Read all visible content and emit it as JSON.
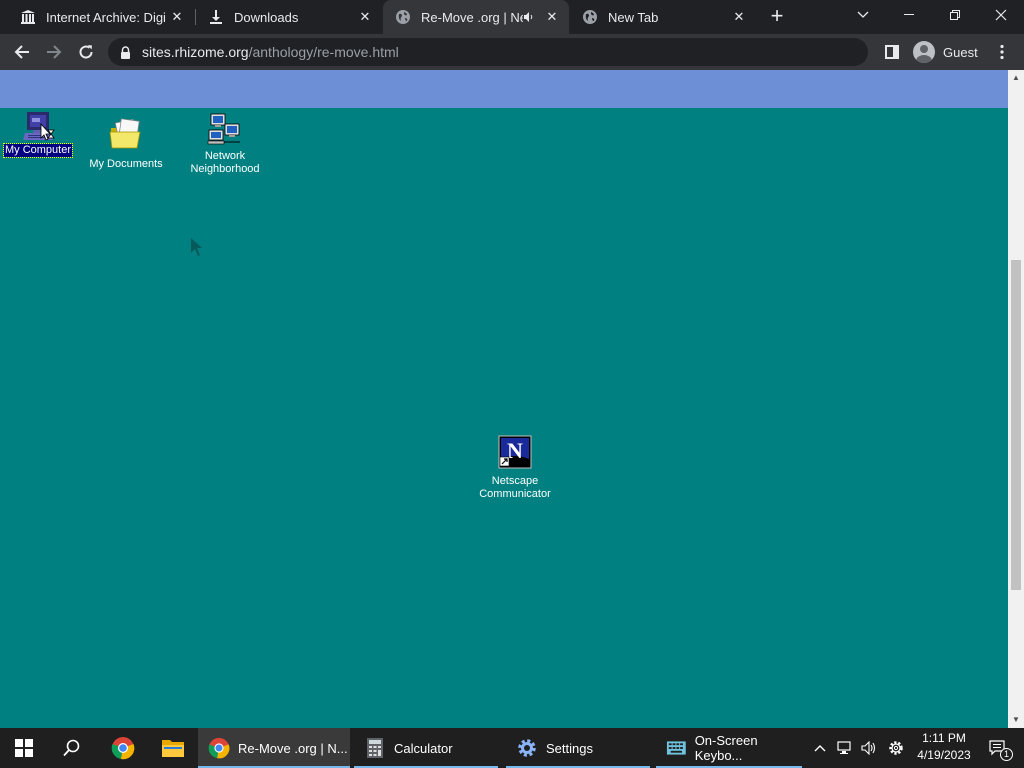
{
  "browser": {
    "tabs": [
      {
        "title": "Internet Archive: Digita",
        "icon": "museum-icon"
      },
      {
        "title": "Downloads",
        "icon": "download-icon"
      },
      {
        "title": "Re-Move .org | Net",
        "icon": "globe-icon",
        "active": true
      },
      {
        "title": "New Tab",
        "icon": "globe-icon"
      }
    ],
    "url_host": "sites.rhizome.org",
    "url_path": "/anthology/re-move.html",
    "profile_label": "Guest"
  },
  "desktop": {
    "background_color": "#008080",
    "banner_color": "#6d8fd6",
    "icons": [
      {
        "label": "My Computer",
        "icon": "computer-icon",
        "selected": true
      },
      {
        "label": "My Documents",
        "icon": "folder-icon"
      },
      {
        "label": "Network Neighborhood",
        "label_line1": "Network",
        "label_line2": "Neighborhood",
        "icon": "network-icon"
      },
      {
        "label": "Netscape Communicator",
        "label_line1": "Netscape",
        "label_line2": "Communicator",
        "icon": "netscape-icon"
      }
    ]
  },
  "taskbar": {
    "apps": [
      {
        "label": "Re-Move .org | N...",
        "icon": "chrome-icon",
        "active": true
      },
      {
        "label": "Calculator",
        "icon": "calculator-icon"
      },
      {
        "label": "Settings",
        "icon": "settings-gear-icon"
      },
      {
        "label": "On-Screen Keybo...",
        "icon": "keyboard-icon"
      }
    ],
    "time": "1:11 PM",
    "date": "4/19/2023",
    "notification_count": "1"
  }
}
